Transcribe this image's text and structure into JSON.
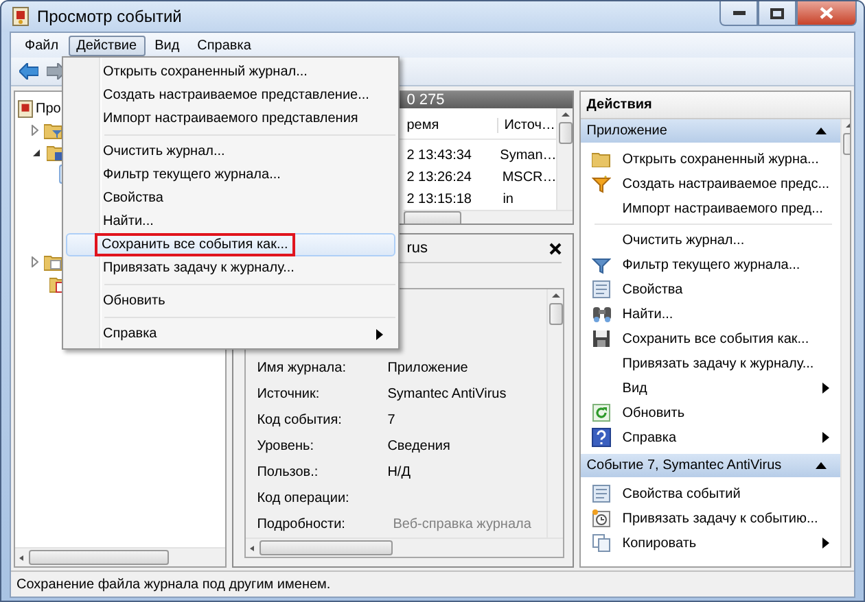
{
  "window": {
    "title": "Просмотр событий"
  },
  "menu_bar": [
    {
      "label": "Файл",
      "selected": false
    },
    {
      "label": "Действие",
      "selected": true
    },
    {
      "label": "Вид",
      "selected": false
    },
    {
      "label": "Справка",
      "selected": false
    }
  ],
  "action_menu": [
    {
      "kind": "item",
      "label": "Открыть сохраненный журнал...",
      "selected": false,
      "submenu": false
    },
    {
      "kind": "item",
      "label": "Создать настраиваемое представление...",
      "selected": false,
      "submenu": false
    },
    {
      "kind": "item",
      "label": "Импорт настраиваемого представления",
      "selected": false,
      "submenu": false
    },
    {
      "kind": "separator"
    },
    {
      "kind": "item",
      "label": "Очистить журнал...",
      "selected": false,
      "submenu": false
    },
    {
      "kind": "item",
      "label": "Фильтр текущего журнала...",
      "selected": false,
      "submenu": false
    },
    {
      "kind": "item",
      "label": "Свойства",
      "selected": false,
      "submenu": false
    },
    {
      "kind": "item",
      "label": "Найти...",
      "selected": false,
      "submenu": false
    },
    {
      "kind": "item",
      "label": "Сохранить все события как...",
      "selected": true,
      "submenu": false
    },
    {
      "kind": "item",
      "label": "Привязать задачу к журналу...",
      "selected": false,
      "submenu": false
    },
    {
      "kind": "separator"
    },
    {
      "kind": "item",
      "label": "Обновить",
      "selected": false,
      "submenu": false
    },
    {
      "kind": "separator"
    },
    {
      "kind": "item",
      "label": "Справка",
      "selected": false,
      "submenu": true
    }
  ],
  "tree": {
    "root_label": "Про",
    "nodes": [
      {
        "kind": "filter-folder",
        "expandable": true,
        "expanded": false
      },
      {
        "kind": "logs-folder",
        "expandable": true,
        "expanded": true
      },
      {
        "kind": "folder",
        "expandable": true,
        "expanded": false
      },
      {
        "kind": "calendar-folder",
        "expandable": false,
        "expanded": false
      }
    ]
  },
  "log_header": {
    "count": "0 275"
  },
  "events_table": {
    "columns": [
      "ремя",
      "Источ…"
    ],
    "rows": [
      [
        "2 13:43:34",
        "Syman…"
      ],
      [
        "2 13:26:24",
        "MSCR…"
      ],
      [
        "2 13:15:18",
        "in"
      ]
    ]
  },
  "event_details": {
    "title": "rus",
    "fields": [
      {
        "label": "Имя журнала:",
        "value": "Приложение",
        "kind": "text"
      },
      {
        "label": "Источник:",
        "value": "Symantec AntiVirus",
        "kind": "text"
      },
      {
        "label": "Код события:",
        "value": "7",
        "kind": "text"
      },
      {
        "label": "Уровень:",
        "value": "Сведения",
        "kind": "text"
      },
      {
        "label": "Пользов.:",
        "value": "Н/Д",
        "kind": "text"
      },
      {
        "label": "Код операции:"
      },
      {
        "label": "Подробности:",
        "value": "Веб-справка журнала",
        "kind": "link"
      }
    ]
  },
  "actions": {
    "title": "Действия",
    "sections": [
      {
        "title": "Приложение",
        "expanded": true,
        "items": [
          {
            "kind": "folder",
            "label": "Открыть сохраненный журна...",
            "submenu": false
          },
          {
            "kind": "funnel-star",
            "label": "Создать настраиваемое предс...",
            "submenu": false
          },
          {
            "kind": "plain",
            "label": "Импорт настраиваемого пред...",
            "submenu": false
          },
          {
            "kind": "separator"
          },
          {
            "kind": "plain",
            "label": "Очистить журнал...",
            "submenu": false
          },
          {
            "kind": "funnel",
            "label": "Фильтр текущего журнала...",
            "submenu": false
          },
          {
            "kind": "properties",
            "label": "Свойства",
            "submenu": false
          },
          {
            "kind": "find",
            "label": "Найти...",
            "submenu": false
          },
          {
            "kind": "save",
            "label": "Сохранить все события как...",
            "submenu": false
          },
          {
            "kind": "plain",
            "label": "Привязать задачу к журналу...",
            "submenu": false
          },
          {
            "kind": "plain",
            "label": "Вид",
            "submenu": true
          },
          {
            "kind": "refresh",
            "label": "Обновить",
            "submenu": false
          },
          {
            "kind": "help",
            "label": "Справка",
            "submenu": true
          }
        ]
      },
      {
        "title": "Событие 7, Symantec AntiVirus",
        "expanded": true,
        "items": [
          {
            "kind": "properties",
            "label": "Свойства событий",
            "submenu": false
          },
          {
            "kind": "task",
            "label": "Привязать задачу к событию...",
            "submenu": false
          },
          {
            "kind": "copy",
            "label": "Копировать",
            "submenu": true
          }
        ]
      }
    ]
  },
  "status_bar": {
    "text": "Сохранение файла журнала под другим именем."
  }
}
